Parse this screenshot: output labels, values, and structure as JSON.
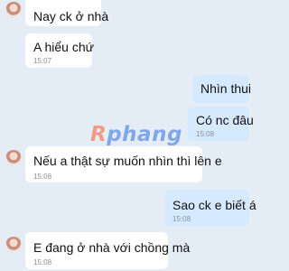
{
  "watermark": {
    "first_letter": "R",
    "rest": "phang"
  },
  "messages": [
    {
      "side": "left",
      "text": "Nay ck ở nhà",
      "time": ""
    },
    {
      "side": "left",
      "text": "A hiểu chứ",
      "time": "15:07"
    },
    {
      "side": "right",
      "text": "Nhìn thui",
      "time": ""
    },
    {
      "side": "right",
      "text": "Có nc đâu",
      "time": "15:08"
    },
    {
      "side": "left",
      "text": "Nếu a thật sự muốn nhìn thì lên e",
      "time": "15:08"
    },
    {
      "side": "right",
      "text": "Sao ck e biết á",
      "time": "15:08"
    },
    {
      "side": "left",
      "text": "E đang ở nhà với chồng mà",
      "time": "15:08"
    }
  ]
}
